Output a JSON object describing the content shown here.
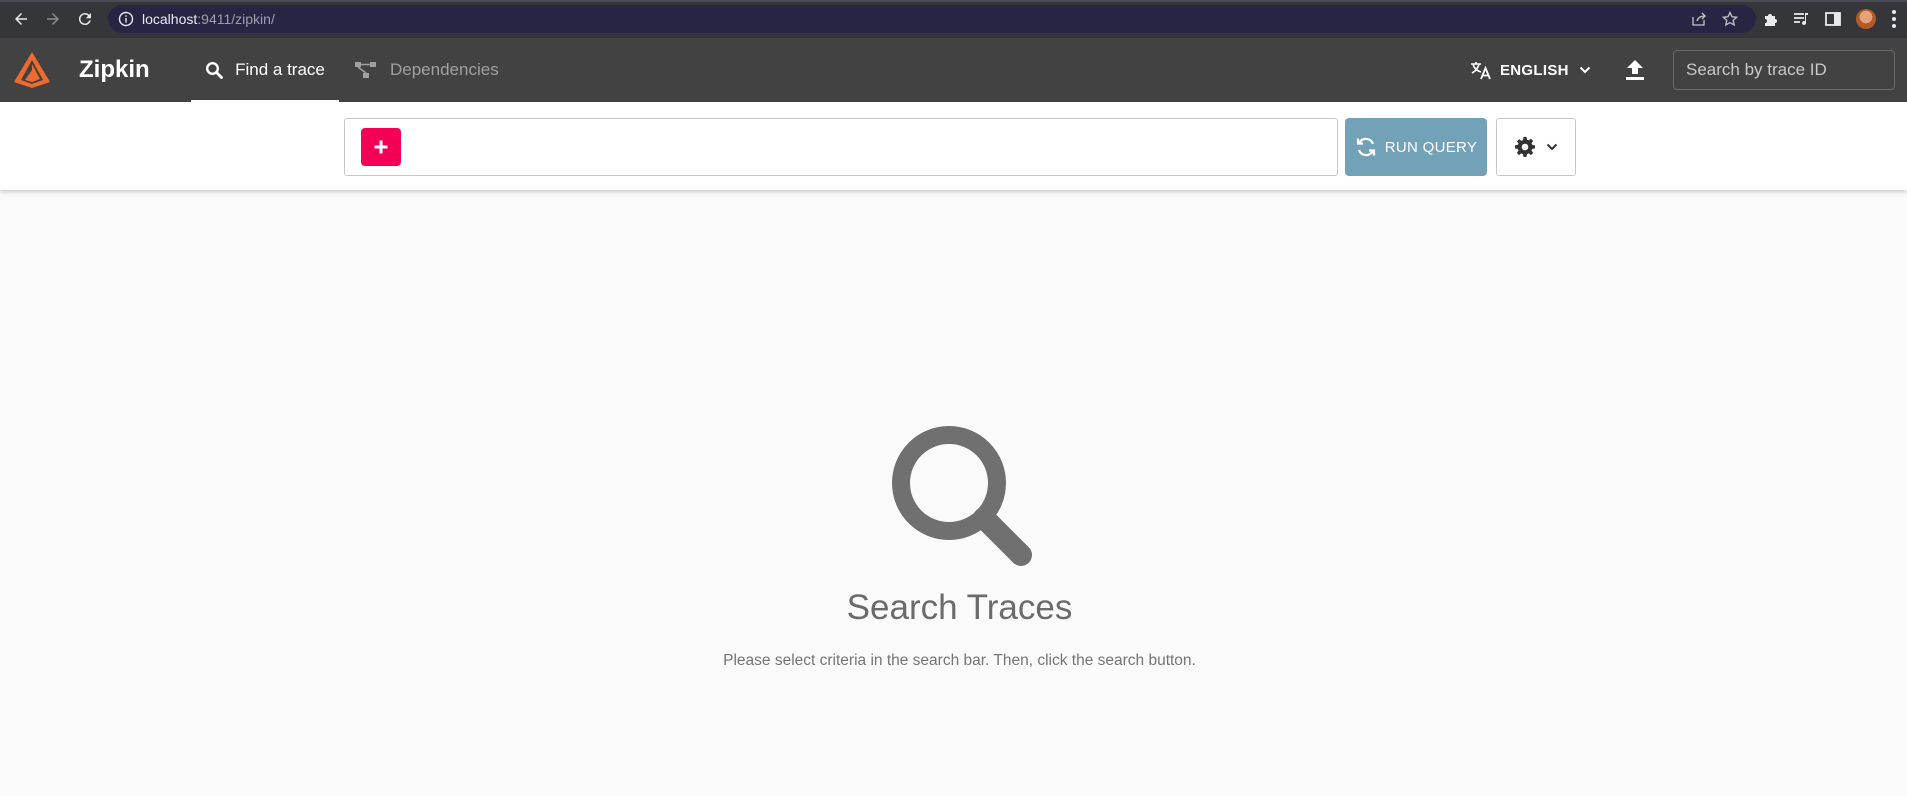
{
  "browser": {
    "url_host": "localhost",
    "url_rest": ":9411/zipkin/"
  },
  "app": {
    "brand": "Zipkin",
    "tabs": [
      {
        "label": "Find a trace",
        "active": true
      },
      {
        "label": "Dependencies",
        "active": false
      }
    ],
    "language": "ENGLISH",
    "trace_search_placeholder": "Search by trace ID"
  },
  "query": {
    "run_label": "RUN QUERY"
  },
  "empty_state": {
    "title": "Search Traces",
    "subtitle": "Please select criteria in the search bar. Then, click the search button."
  },
  "colors": {
    "header_bg": "#424242",
    "accent_add": "#f50057",
    "run_button": "#72a2b8",
    "logo_orange": "#ee6b2f"
  }
}
